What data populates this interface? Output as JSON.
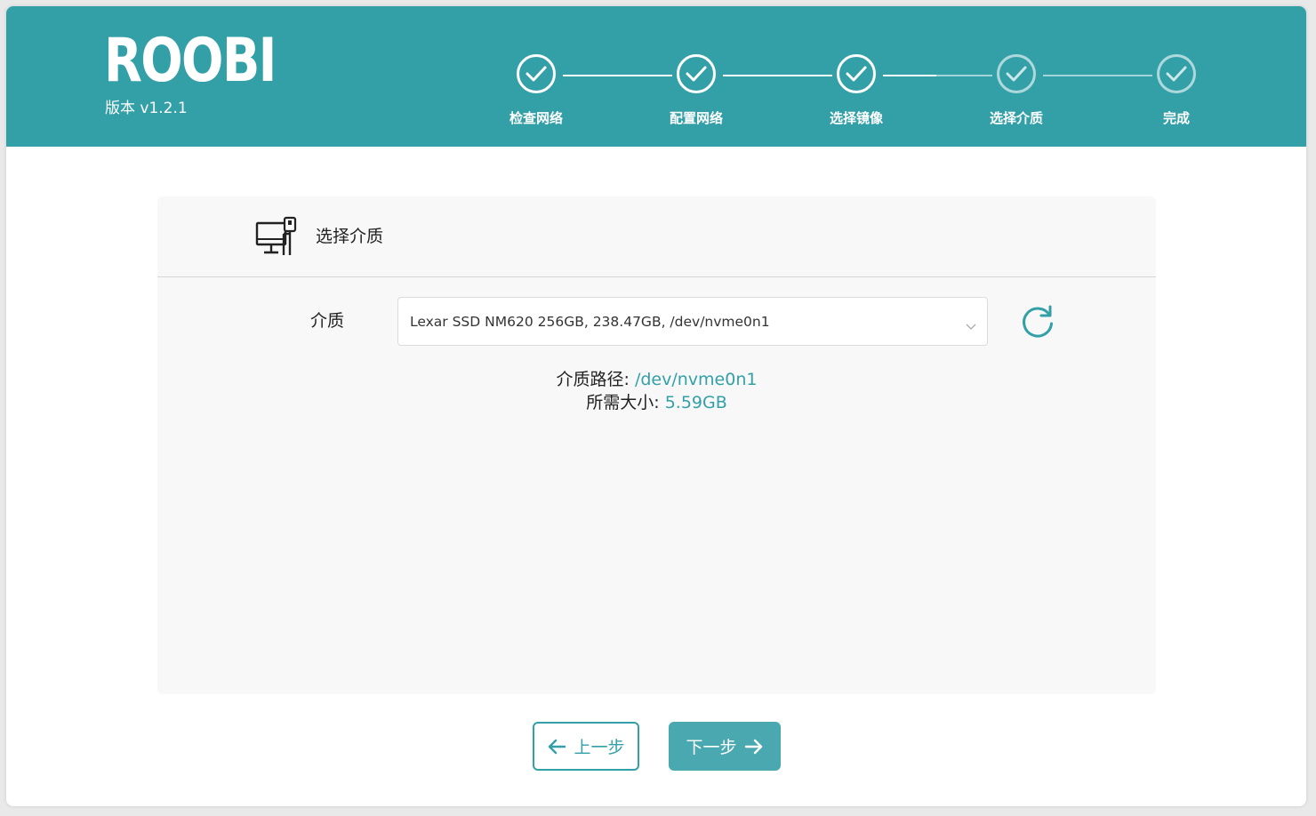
{
  "header": {
    "logo": "ROOBI",
    "version": "版本 v1.2.1"
  },
  "steps": [
    {
      "label": "检查网络",
      "status": "done"
    },
    {
      "label": "配置网络",
      "status": "done"
    },
    {
      "label": "选择镜像",
      "status": "done"
    },
    {
      "label": "选择介质",
      "status": "current"
    },
    {
      "label": "完成",
      "status": "pending"
    }
  ],
  "panel": {
    "title": "选择介质",
    "icon": "computer-usb-icon",
    "field_label": "介质",
    "select_value": "Lexar SSD NM620 256GB, 238.47GB, /dev/nvme0n1",
    "refresh_icon": "refresh-icon",
    "path_label": "介质路径: ",
    "path_value": "/dev/nvme0n1",
    "size_label": "所需大小: ",
    "size_value": "5.59GB"
  },
  "buttons": {
    "prev_label": "上一步",
    "next_label": "下一步"
  },
  "colors": {
    "accent": "#33a0a8",
    "next_button": "#4aa9b0"
  }
}
